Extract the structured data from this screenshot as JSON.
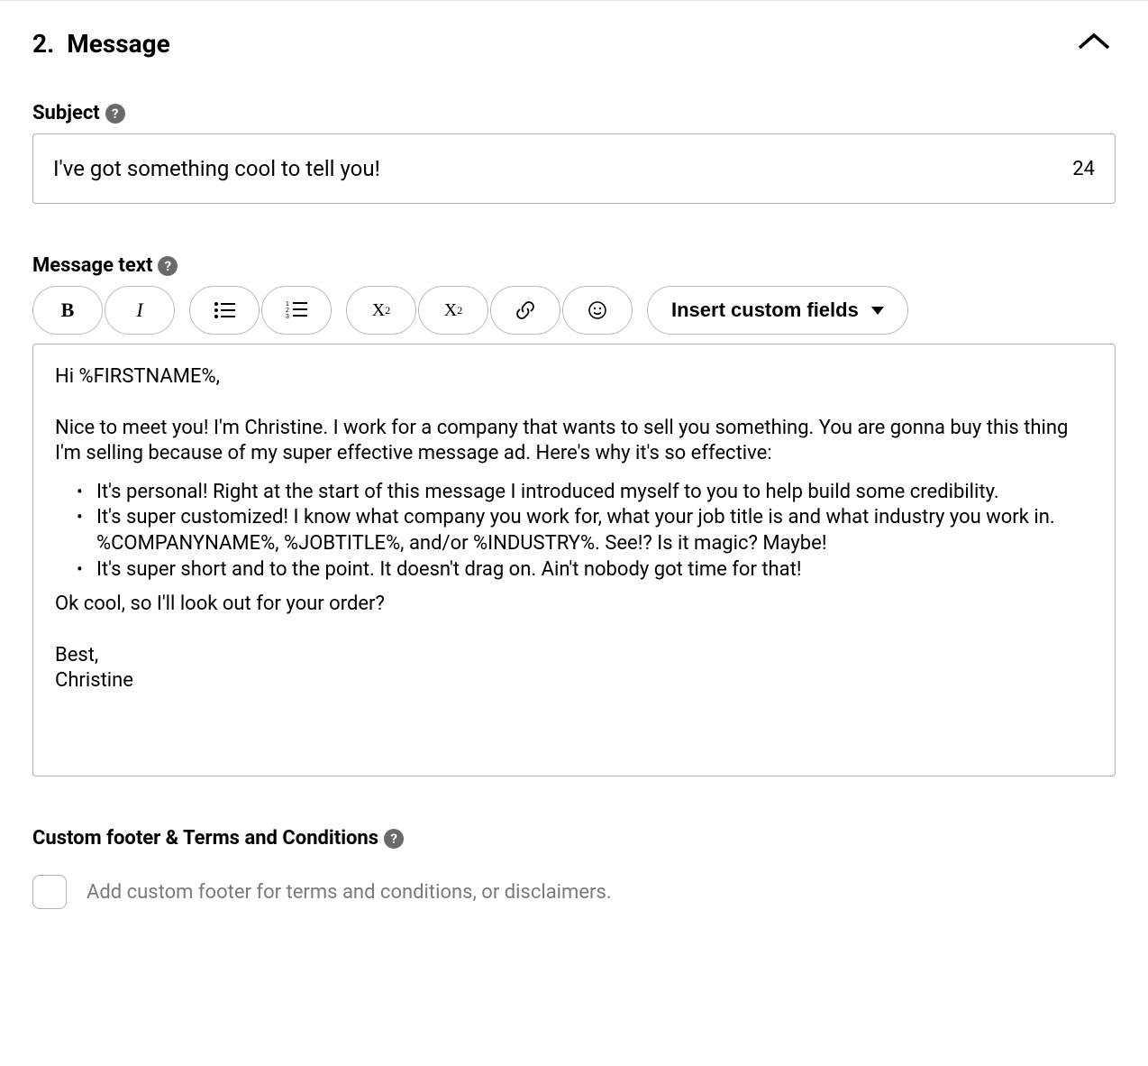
{
  "section": {
    "number": "2.",
    "title": "Message"
  },
  "subject": {
    "label": "Subject",
    "value": "I've got something cool to tell you!",
    "char_count": "24"
  },
  "messageText": {
    "label": "Message text",
    "toolbar": {
      "bold": "B",
      "italic": "I",
      "superscript_base": "X",
      "superscript_exp": "2",
      "subscript_base": "X",
      "subscript_exp": "2",
      "custom_fields": "Insert custom fields"
    },
    "body": {
      "greeting": "Hi %FIRSTNAME%,",
      "intro": "Nice to meet you! I'm Christine. I work for a company that wants to sell you something. You are gonna buy this thing I'm selling because of my super effective message ad. Here's why it's so effective:",
      "bullets": [
        "It's personal! Right at the start of this message I introduced myself to you to help build some credibility.",
        "It's super customized! I know what company you work for, what your job title is and what industry you work in. %COMPANYNAME%, %JOBTITLE%, and/or %INDUSTRY%. See!? Is it magic? Maybe!",
        "It's super short and to the point. It doesn't drag on. Ain't nobody got time for that!"
      ],
      "closing": "Ok cool, so I'll look out for your order?",
      "signoff1": "Best,",
      "signoff2": "Christine"
    }
  },
  "footer": {
    "label": "Custom footer & Terms and Conditions",
    "checkbox_label": "Add custom footer for terms and conditions, or disclaimers."
  }
}
